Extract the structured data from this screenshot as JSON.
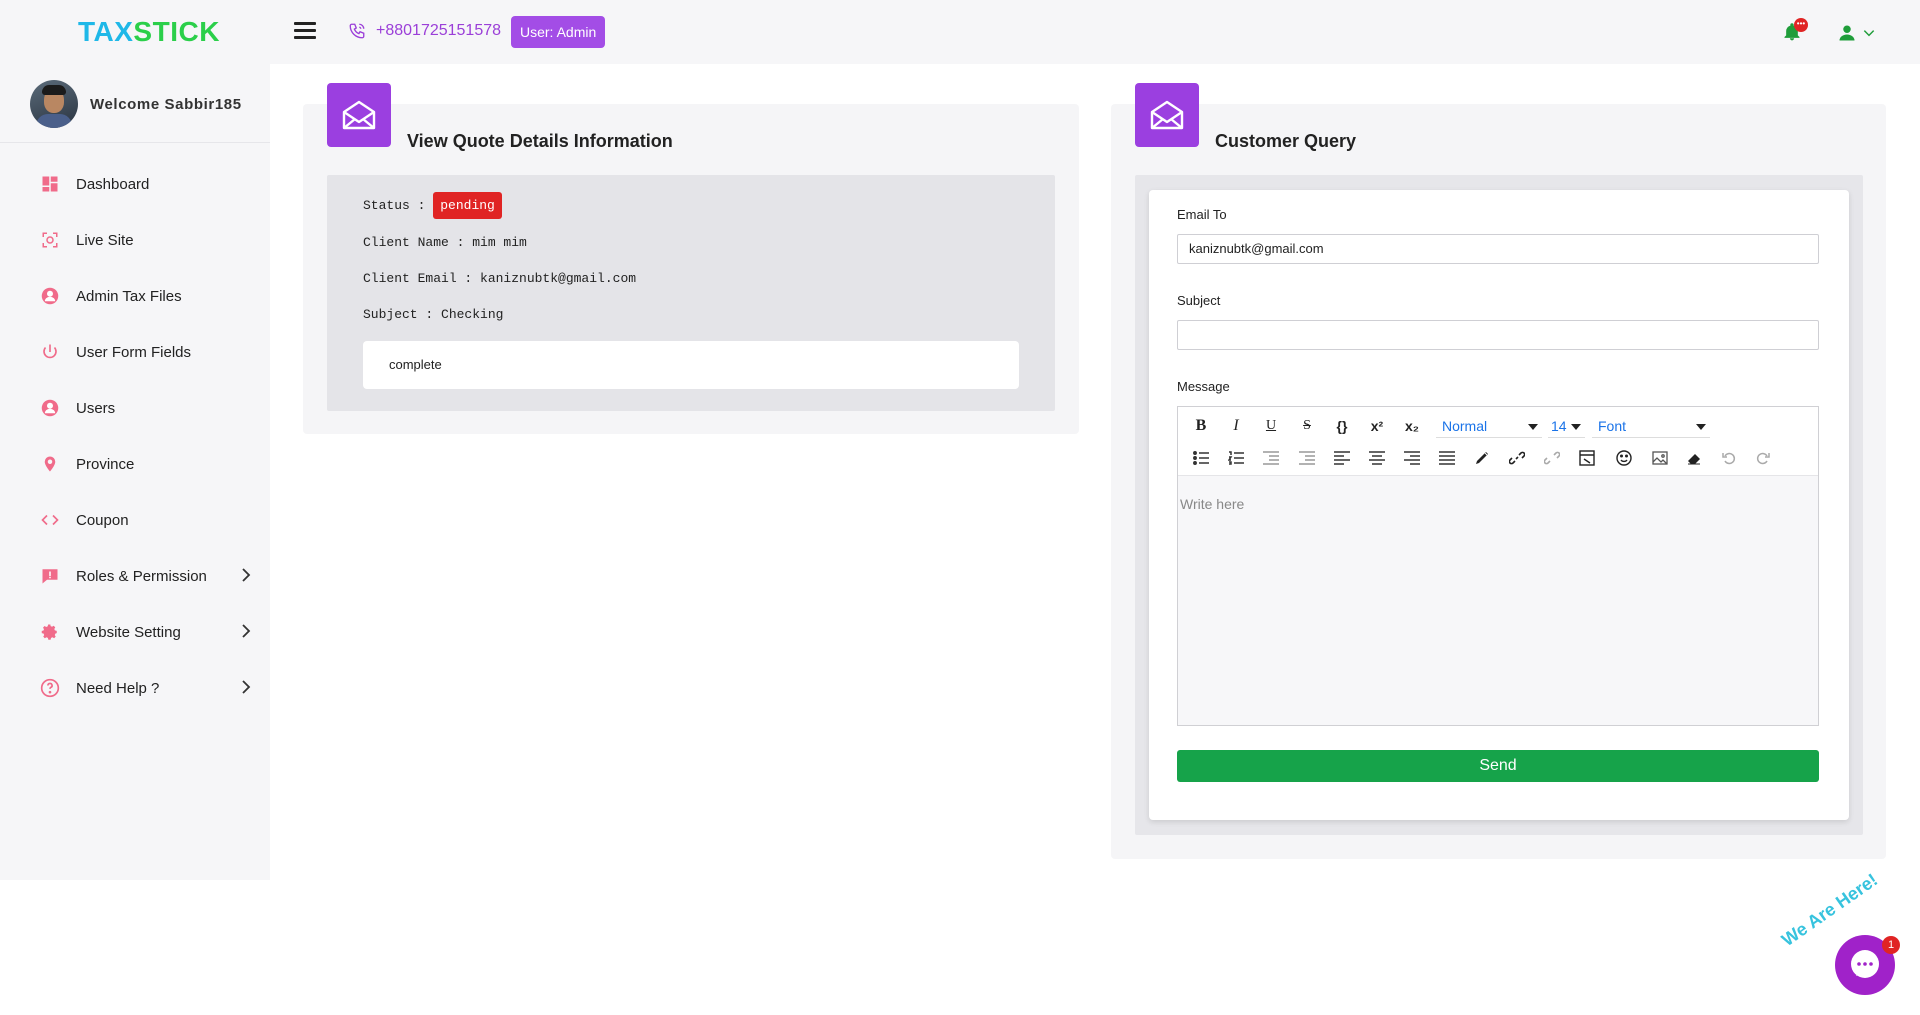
{
  "header": {
    "logo_part1": "TAX",
    "logo_part2": "STICK",
    "phone": "+8801725151578",
    "user_badge": "User: Admin",
    "notification_count": "•••",
    "accent_color": "#9b3fe0"
  },
  "sidebar": {
    "welcome": "Welcome Sabbir185",
    "items": [
      {
        "label": "Dashboard",
        "icon": "dashboard-icon"
      },
      {
        "label": "Live Site",
        "icon": "focus-icon"
      },
      {
        "label": "Admin Tax Files",
        "icon": "user-circle-icon"
      },
      {
        "label": "User Form Fields",
        "icon": "power-icon"
      },
      {
        "label": "Users",
        "icon": "user-circle-icon"
      },
      {
        "label": "Province",
        "icon": "location-pin-icon"
      },
      {
        "label": "Coupon",
        "icon": "code-icon"
      },
      {
        "label": "Roles & Permission",
        "icon": "alert-message-icon"
      },
      {
        "label": "Website Setting",
        "icon": "gear-icon"
      },
      {
        "label": "Need Help ?",
        "icon": "help-icon"
      }
    ]
  },
  "quote": {
    "title": "View Quote Details Information",
    "status_label": "Status :",
    "status_value": "pending",
    "client_name": "Client Name : mim mim",
    "client_email": "Client Email : kaniznubtk@gmail.com",
    "subject": "Subject : Checking",
    "message": "complete"
  },
  "query": {
    "title": "Customer Query",
    "email_label": "Email To",
    "email_value": "kaniznubtk@gmail.com",
    "subject_label": "Subject",
    "subject_value": "",
    "message_label": "Message",
    "format_value": "Normal",
    "size_value": "14",
    "font_value": "Font",
    "placeholder": "Write here",
    "send_label": "Send"
  },
  "chat": {
    "tagline": "We Are Here!",
    "unread": "1"
  }
}
